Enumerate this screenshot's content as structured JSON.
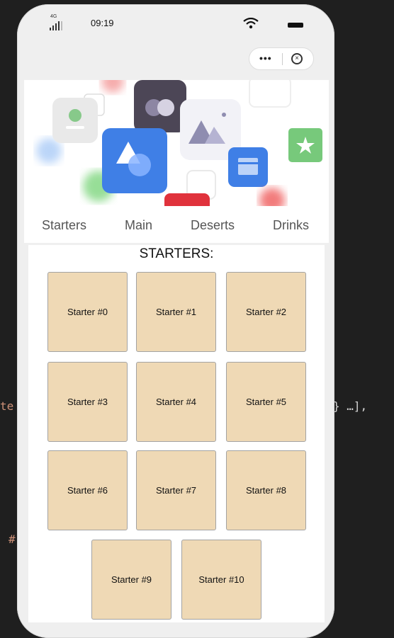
{
  "background_code": {
    "left": "te",
    "right": "} …],",
    "hash": "#"
  },
  "status_bar": {
    "network": "4G",
    "time": "09:19"
  },
  "capsule": {
    "more": "•••"
  },
  "tabs": [
    "Starters",
    "Main",
    "Deserts",
    "Drinks"
  ],
  "section_title": "STARTERS:",
  "items": [
    "Starter #0",
    "Starter #1",
    "Starter #2",
    "Starter #3",
    "Starter #4",
    "Starter #5",
    "Starter #6",
    "Starter #7",
    "Starter #8",
    "Starter #9",
    "Starter #10"
  ],
  "colors": {
    "card_bg": "#efd9b5",
    "card_border": "#a3a3a3",
    "page_bg": "#1f1f1f",
    "phone_bg": "#efefef"
  }
}
